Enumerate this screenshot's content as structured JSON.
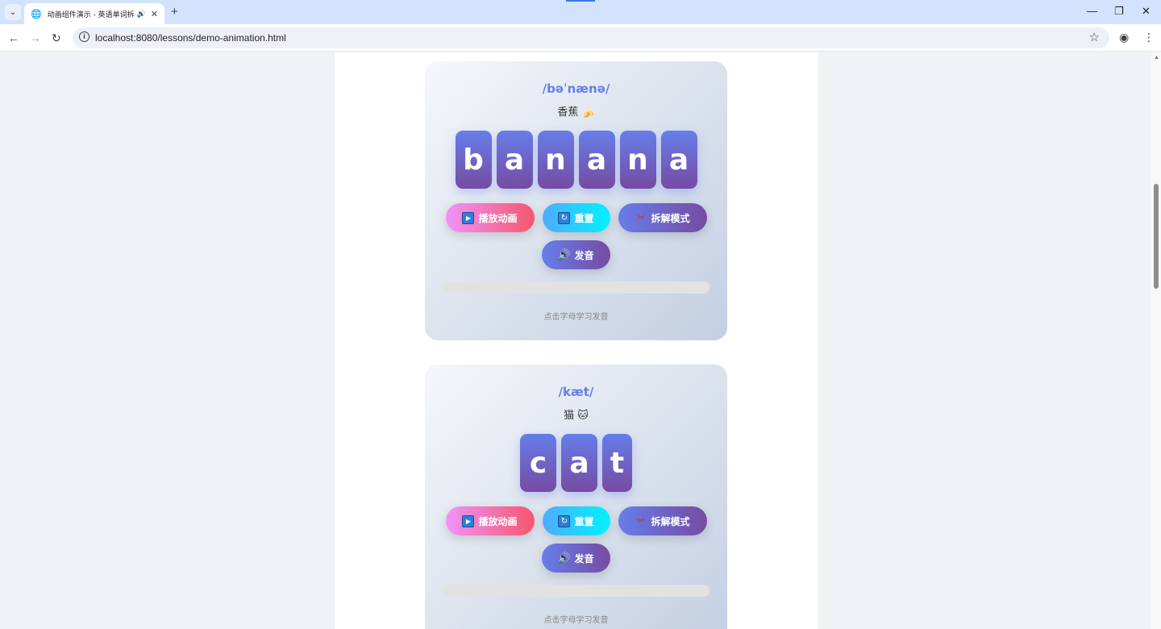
{
  "browser": {
    "tab_title": "动画组件演示 - 英语单词拆",
    "url": "localhost:8080/lessons/demo-animation.html"
  },
  "cards": [
    {
      "phonetic": "/bəˈnænə/",
      "meaning": "香蕉 🍌",
      "letters": [
        "b",
        "a",
        "n",
        "a",
        "n",
        "a"
      ],
      "buttons": {
        "play": "播放动画",
        "reset": "重置",
        "split": "拆解模式",
        "sound": "发音"
      },
      "progress": 0,
      "hint": "点击字母学习发音"
    },
    {
      "phonetic": "/kæt/",
      "meaning": "猫 🐱",
      "letters": [
        "c",
        "a",
        "t"
      ],
      "buttons": {
        "play": "播放动画",
        "reset": "重置",
        "split": "拆解模式",
        "sound": "发音"
      },
      "progress": 0,
      "hint": "点击字母学习发音"
    }
  ],
  "icons": {
    "play": "play-icon",
    "reset": "refresh-icon",
    "split": "scissors-icon",
    "sound": "speaker-icon"
  },
  "colors": {
    "accent": "#667eea",
    "accent_end": "#764ba2",
    "play_start": "#f093fb",
    "play_end": "#f5576c",
    "reset_start": "#4facfe",
    "reset_end": "#00f2fe"
  }
}
